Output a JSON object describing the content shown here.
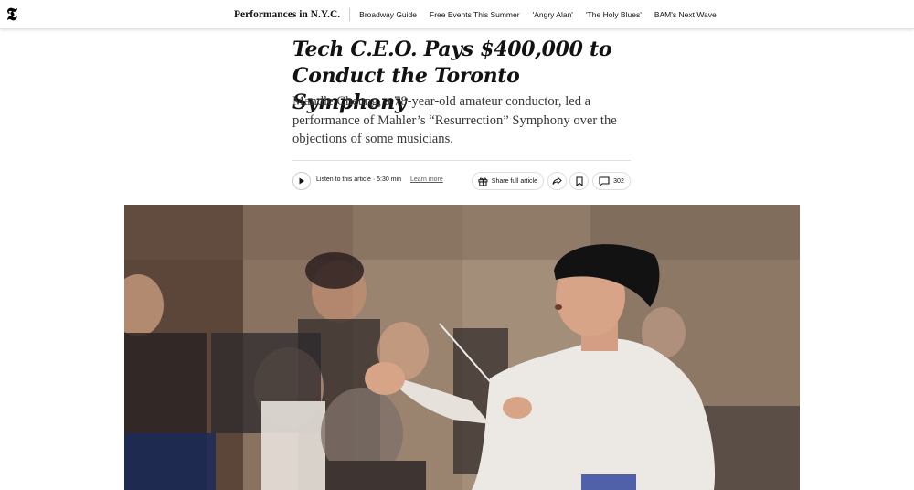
{
  "topbar": {
    "logo": "𝕿",
    "section": "Performances in N.Y.C.",
    "links": [
      "Broadway Guide",
      "Free Events This Summer",
      "'Angry Alan'",
      "'The Holy Blues'",
      "BAM's Next Wave"
    ]
  },
  "article": {
    "headline": "Tech C.E.O. Pays $400,000 to Conduct the Toronto Symphony",
    "summary": "Mandle Cheung, a 78-year-old amateur conductor, led a performance of Mahler’s “Resurrection” Symphony over the objections of some musicians."
  },
  "toolbar": {
    "listen_label": "Listen to this article · 5:30 min",
    "learn_more": "Learn more",
    "share_full": "Share full article",
    "comment_count": "302"
  },
  "icons": {
    "play": "play-icon",
    "gift": "gift-icon",
    "share": "share-icon",
    "bookmark": "bookmark-icon",
    "comment": "comment-icon"
  }
}
